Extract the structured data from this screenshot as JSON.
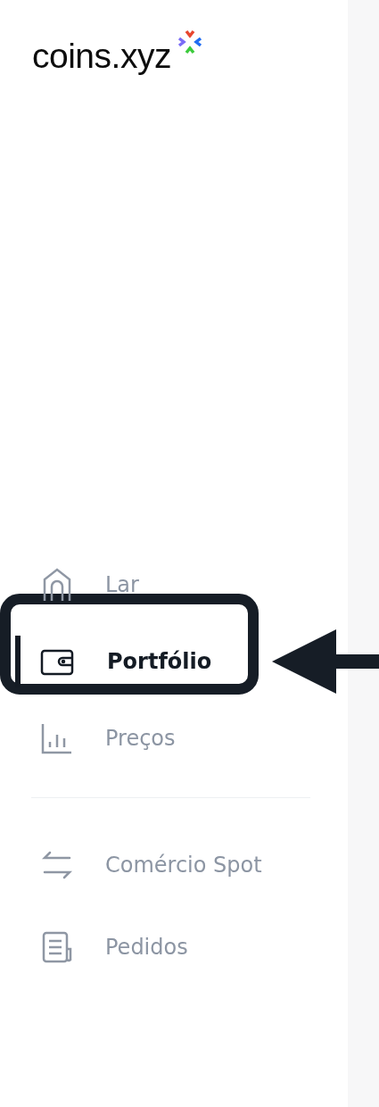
{
  "logo": {
    "text": "coins.xyz"
  },
  "nav_groups": [
    [
      {
        "label": "Lar",
        "selected": false
      },
      {
        "label": "Portfólio",
        "selected": true
      },
      {
        "label": "Preços",
        "selected": false
      }
    ],
    [
      {
        "label": "Comércio Spot",
        "selected": false
      },
      {
        "label": "Pedidos",
        "selected": false
      }
    ]
  ]
}
